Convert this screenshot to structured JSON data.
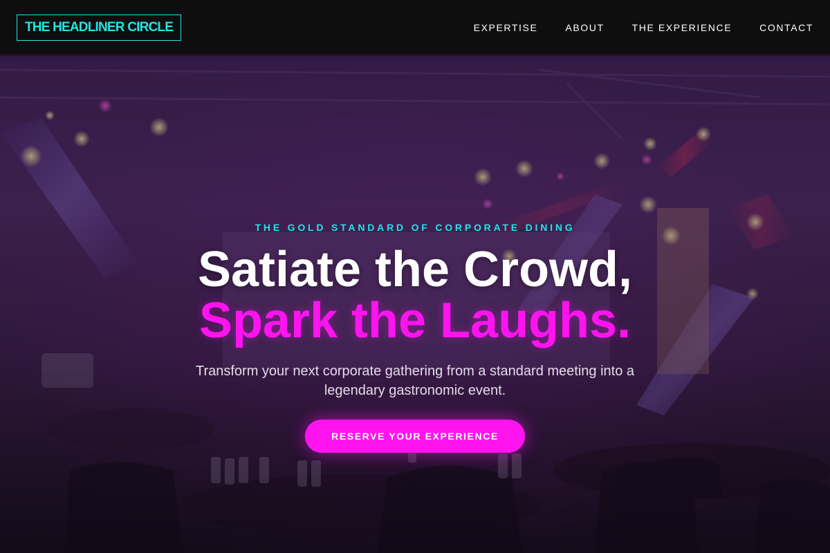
{
  "brand": {
    "logo_text": "THE HEADLINER CIRCLE"
  },
  "nav": {
    "items": [
      {
        "label": "EXPERTISE"
      },
      {
        "label": "ABOUT"
      },
      {
        "label": "THE EXPERIENCE"
      },
      {
        "label": "CONTACT"
      }
    ]
  },
  "hero": {
    "eyebrow": "THE GOLD STANDARD OF CORPORATE DINING",
    "headline_line1": "Satiate the Crowd,",
    "headline_line2": "Spark the Laughs.",
    "subtext": "Transform your next corporate gathering from a standard meeting into a legendary gastronomic event.",
    "cta_label": "RESERVE YOUR EXPERIENCE",
    "background_image": "banquet-hall-with-stage-lights"
  },
  "colors": {
    "accent_cyan": "#22e5e5",
    "accent_magenta": "#ff14f0",
    "nav_background": "#0e0e0e"
  }
}
